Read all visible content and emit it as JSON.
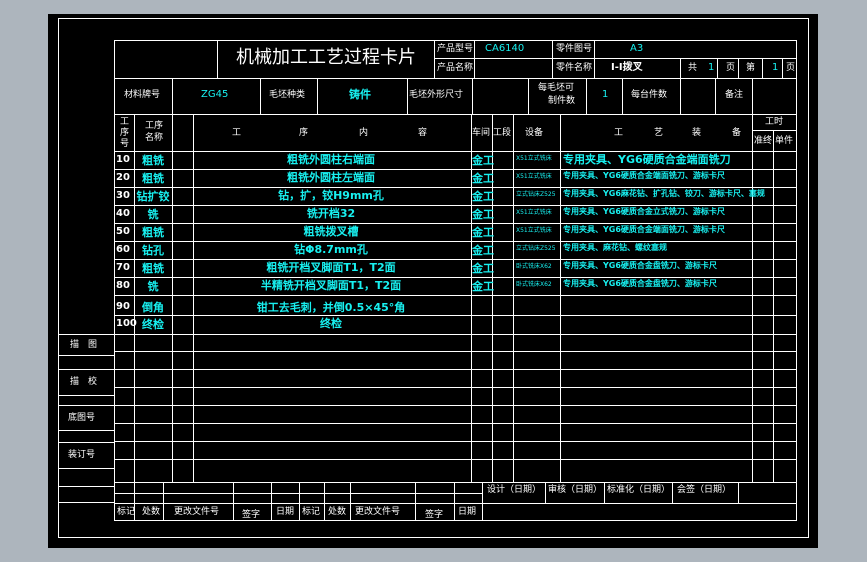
{
  "header": {
    "title": "机械加工工艺过程卡片",
    "product_model_label": "产品型号",
    "product_model_value": "CA6140",
    "part_number_label": "零件图号",
    "part_number_value": "A3",
    "product_name_label": "产品名称",
    "part_name_label": "零件名称",
    "part_name_value": "I-I拨叉",
    "total_label": "共",
    "total_value": "1",
    "page_label": "页",
    "sheet_label": "第",
    "sheet_value": "1",
    "page_label2": "页"
  },
  "material": {
    "material_label": "材料牌号",
    "material_value": "ZG45",
    "blank_type_label": "毛坯种类",
    "blank_type_value": "铸件",
    "blank_size_label": "毛坯外形尺寸",
    "per_blank_label_1": "每毛坯可",
    "per_blank_label_2": "制件数",
    "per_blank_value": "1",
    "per_unit_label": "每台件数",
    "remark_label": "备注"
  },
  "columns": {
    "seq_1": "工",
    "seq_2": "序",
    "seq_3": "号",
    "name_1": "工序",
    "name_2": "名称",
    "content_1": "工",
    "content_2": "序",
    "content_3": "内",
    "content_4": "容",
    "workshop": "车间",
    "section": "工段",
    "equipment": "设备",
    "tooling_1": "工",
    "tooling_2": "艺",
    "tooling_3": "装",
    "tooling_4": "备",
    "hours": "工时",
    "prep": "准终",
    "unit": "单件"
  },
  "rows": [
    {
      "no": "10",
      "name": "粗铣",
      "content": "粗铣外圆柱右端面",
      "workshop": "金工",
      "equipment": "X51立式铣床",
      "tooling": "专用夹具、YG6硬质合金端面铣刀"
    },
    {
      "no": "20",
      "name": "粗铣",
      "content": "粗铣外圆柱左端面",
      "workshop": "金工",
      "equipment": "X51立式铣床",
      "tooling": "专用夹具、YG6硬质合金端面铣刀、游标卡尺"
    },
    {
      "no": "30",
      "name": "钻扩铰",
      "content": "钻，扩，铰H9mm孔",
      "workshop": "金工",
      "equipment": "立式钻床Z525",
      "tooling": "专用夹具、YG6麻花钻、扩孔钻、铰刀、游标卡尺、塞规"
    },
    {
      "no": "40",
      "name": "铣",
      "content": "铣开档32",
      "workshop": "金工",
      "equipment": "X51立式铣床",
      "tooling": "专用夹具、YG6硬质合金立式铣刀、游标卡尺"
    },
    {
      "no": "50",
      "name": "粗铣",
      "content": "粗铣拨叉槽",
      "workshop": "金工",
      "equipment": "X51立式铣床",
      "tooling": "专用夹具、YG6硬质合金端面铣刀、游标卡尺"
    },
    {
      "no": "60",
      "name": "钻孔",
      "content": "钻Φ8.7mm孔",
      "workshop": "金工",
      "equipment": "立式钻床Z525",
      "tooling": "专用夹具、麻花钻、螺纹塞规"
    },
    {
      "no": "70",
      "name": "粗铣",
      "content": "粗铣开档叉脚面T1，T2面",
      "workshop": "金工",
      "equipment": "卧式铣床X62",
      "tooling": "专用夹具、YG6硬质合金盘铣刀、游标卡尺"
    },
    {
      "no": "80",
      "name": "铣",
      "content": "半精铣开档叉脚面T1，T2面",
      "workshop": "金工",
      "equipment": "卧式铣床X62",
      "tooling": "专用夹具、YG6硬质合金盘铣刀、游标卡尺"
    },
    {
      "no": "90",
      "name": "倒角",
      "content": "钳工去毛刺，并倒0.5×45°角",
      "workshop": "",
      "equipment": "",
      "tooling": ""
    },
    {
      "no": "100",
      "name": "终检",
      "content": "终检",
      "workshop": "",
      "equipment": "",
      "tooling": ""
    }
  ],
  "left_labels": {
    "trace": "描　图",
    "proof": "描　校",
    "base_no": "底图号",
    "binding_no": "装订号"
  },
  "footer": {
    "design": "设计（日期）",
    "review": "审核（日期）",
    "standard": "标准化（日期）",
    "sign": "会签（日期）",
    "mark": "标记",
    "count": "处数",
    "change_doc": "更改文件号",
    "signature": "签字",
    "date": "日期",
    "mark2": "标记",
    "count2": "处数",
    "change_doc2": "更改文件号",
    "signature2": "签字",
    "date2": "日期"
  }
}
